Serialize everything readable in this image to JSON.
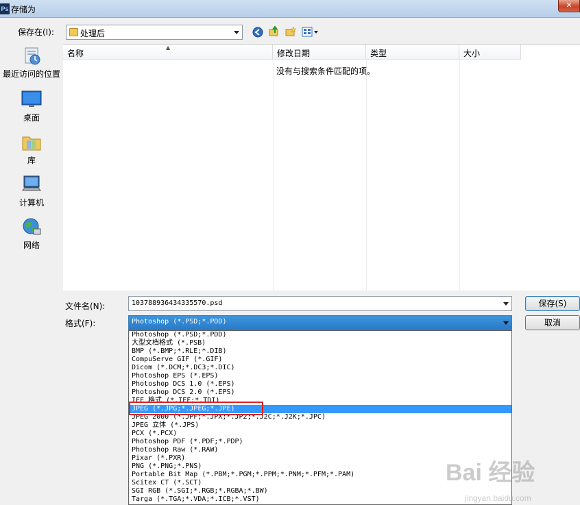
{
  "window": {
    "title": "存储为",
    "app_badge": "Ps",
    "close_glyph": "✕"
  },
  "save_in": {
    "label": "保存在(I):",
    "value": "处理后"
  },
  "places": [
    {
      "label": "最近访问的位置",
      "icon": "recent-places-icon"
    },
    {
      "label": "桌面",
      "icon": "desktop-icon"
    },
    {
      "label": "库",
      "icon": "libraries-icon"
    },
    {
      "label": "计算机",
      "icon": "computer-icon"
    },
    {
      "label": "网络",
      "icon": "network-icon"
    }
  ],
  "file_list": {
    "columns": [
      "名称",
      "修改日期",
      "类型",
      "大小"
    ],
    "empty_message": "没有与搜索条件匹配的项。"
  },
  "file_name": {
    "label": "文件名(N):",
    "value": "103788936434335570.psd"
  },
  "format": {
    "label": "格式(F):",
    "value": "Photoshop (*.PSD;*.PDD)",
    "options": [
      "Photoshop (*.PSD;*.PDD)",
      "大型文档格式 (*.PSB)",
      "BMP (*.BMP;*.RLE;*.DIB)",
      "CompuServe GIF (*.GIF)",
      "Dicom (*.DCM;*.DC3;*.DIC)",
      "Photoshop EPS (*.EPS)",
      "Photoshop DCS 1.0 (*.EPS)",
      "Photoshop DCS 2.0 (*.EPS)",
      "IFF 格式 (*.IFF;*.TDI)",
      "JPEG (*.JPG;*.JPEG;*.JPE)",
      "JPEG 2000 (*.JPF;*.JPX;*.JP2;*.J2C;*.J2K;*.JPC)",
      "JPEG 立体 (*.JPS)",
      "PCX (*.PCX)",
      "Photoshop PDF (*.PDF;*.PDP)",
      "Photoshop Raw (*.RAW)",
      "Pixar (*.PXR)",
      "PNG (*.PNG;*.PNS)",
      "Portable Bit Map (*.PBM;*.PGM;*.PPM;*.PNM;*.PFM;*.PAM)",
      "Scitex CT (*.SCT)",
      "SGI RGB (*.SGI;*.RGB;*.RGBA;*.BW)",
      "Targa (*.TGA;*.VDA;*.ICB;*.VST)"
    ],
    "selected_index": 9
  },
  "buttons": {
    "save": "保存(S)",
    "cancel": "取消"
  },
  "watermark": {
    "brand": "Bai 经验",
    "url": "jingyan.baidu.com"
  },
  "colors": {
    "selection": "#3399ff",
    "highlight_box": "#e02020",
    "combo_active": "#2a7ac7"
  }
}
